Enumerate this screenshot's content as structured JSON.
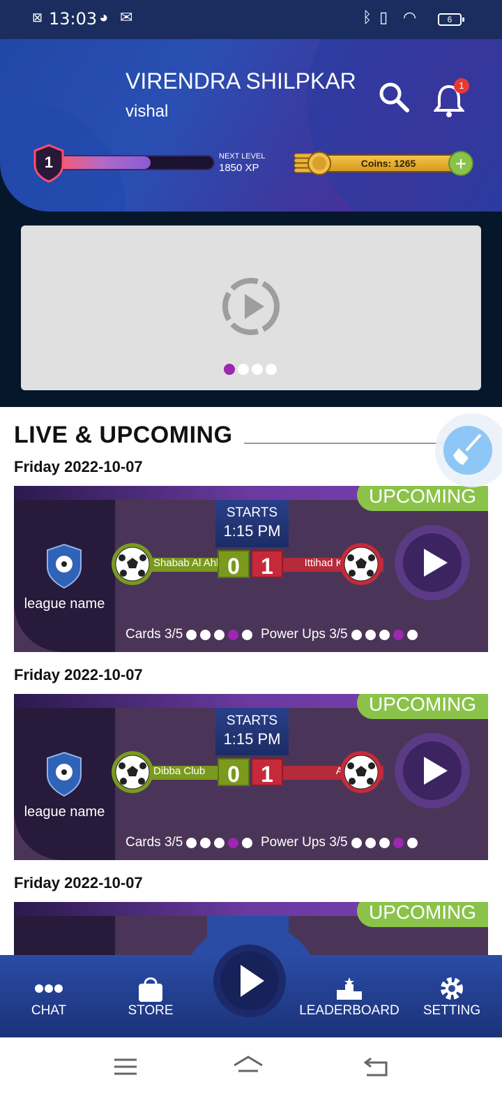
{
  "status_bar": {
    "time": "13:03",
    "battery": "6"
  },
  "header": {
    "user_name": "VIRENDRA SHILPKAR",
    "user_handle": "vishal",
    "level": "1",
    "xp_progress": 0.6,
    "next_level_label": "NEXT LEVEL",
    "next_level_xp": "1850 XP",
    "coins_label": "Coins: 1265",
    "notification_count": "1"
  },
  "banner": {
    "page_count": 4,
    "active_page": 1
  },
  "section": {
    "title": "LIVE & UPCOMING"
  },
  "matches": [
    {
      "date": "Friday 2022-10-07",
      "status": "UPCOMING",
      "league": "league name",
      "starts_label": "STARTS",
      "starts_time": "1:15 PM",
      "home_team": "Shabab Al Ahli",
      "away_team": "Ittihad Kalba",
      "home_score": "0",
      "away_score": "1",
      "cards_label": "Cards 3/5",
      "powerups_label": "Power Ups 3/5"
    },
    {
      "date": "Friday 2022-10-07",
      "status": "UPCOMING",
      "league": "league name",
      "starts_label": "STARTS",
      "starts_time": "1:15 PM",
      "home_team": "Dibba Club",
      "away_team": "Al Ain",
      "home_score": "0",
      "away_score": "1",
      "cards_label": "Cards 3/5",
      "powerups_label": "Power Ups 3/5"
    },
    {
      "date": "Friday 2022-10-07",
      "status": "UPCOMING"
    }
  ],
  "bottom_nav": {
    "chat": "CHAT",
    "store": "STORE",
    "leaderboard": "LEADERBOARD",
    "setting": "SETTING"
  },
  "colors": {
    "accent_green": "#8bc34a",
    "accent_purple": "#9c27b0",
    "nav_blue": "#2a4ca5",
    "card_purple": "#4a3558"
  }
}
